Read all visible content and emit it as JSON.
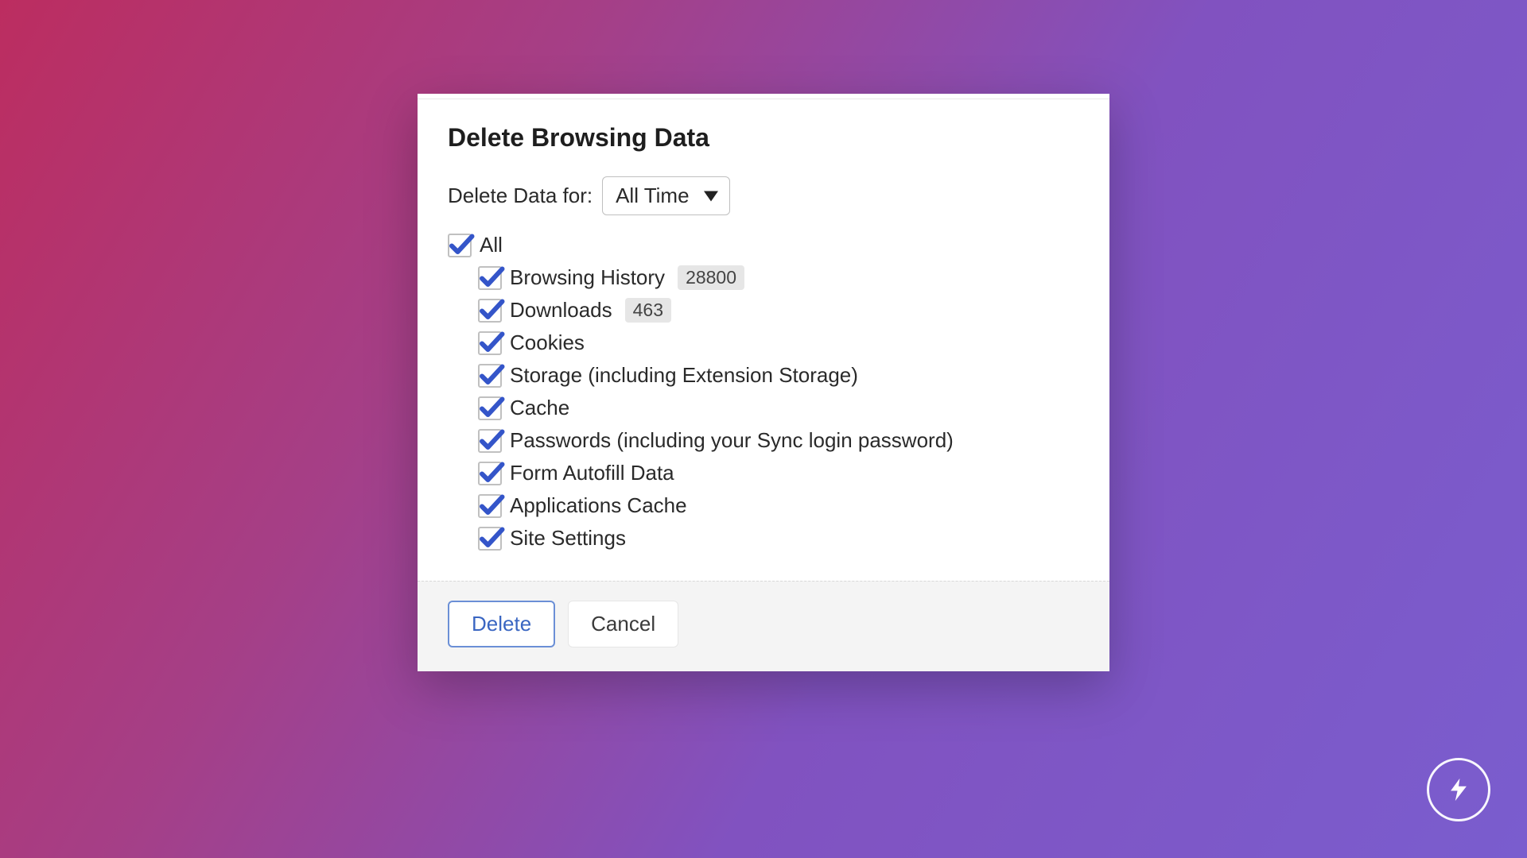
{
  "dialog": {
    "title": "Delete Browsing Data",
    "time_label": "Delete Data for:",
    "time_value": "All Time",
    "all_label": "All",
    "items": [
      {
        "label": "Browsing History",
        "count": "28800"
      },
      {
        "label": "Downloads",
        "count": "463"
      },
      {
        "label": "Cookies"
      },
      {
        "label": "Storage (including Extension Storage)"
      },
      {
        "label": "Cache"
      },
      {
        "label": "Passwords (including your Sync login password)"
      },
      {
        "label": "Form Autofill Data"
      },
      {
        "label": "Applications Cache"
      },
      {
        "label": "Site Settings"
      }
    ],
    "delete_label": "Delete",
    "cancel_label": "Cancel"
  }
}
